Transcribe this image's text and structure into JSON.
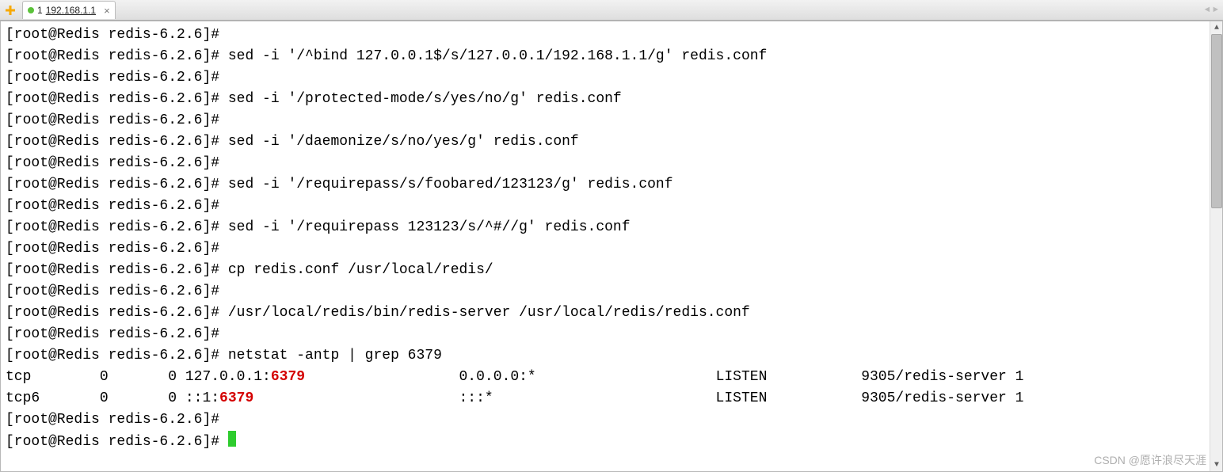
{
  "tab": {
    "index": "1",
    "title": "192.168.1.1",
    "close": "×"
  },
  "prompt": "[root@Redis redis-6.2.6]#",
  "lines": [
    {
      "cmd": ""
    },
    {
      "cmd": " sed -i '/^bind 127.0.0.1$/s/127.0.0.1/192.168.1.1/g' redis.conf"
    },
    {
      "cmd": ""
    },
    {
      "cmd": " sed -i '/protected-mode/s/yes/no/g' redis.conf"
    },
    {
      "cmd": ""
    },
    {
      "cmd": " sed -i '/daemonize/s/no/yes/g' redis.conf"
    },
    {
      "cmd": ""
    },
    {
      "cmd": " sed -i '/requirepass/s/foobared/123123/g' redis.conf"
    },
    {
      "cmd": ""
    },
    {
      "cmd": " sed -i '/requirepass 123123/s/^#//g' redis.conf"
    },
    {
      "cmd": ""
    },
    {
      "cmd": " cp redis.conf /usr/local/redis/"
    },
    {
      "cmd": ""
    },
    {
      "cmd": " /usr/local/redis/bin/redis-server /usr/local/redis/redis.conf"
    },
    {
      "cmd": ""
    },
    {
      "cmd": " netstat -antp | grep 6379"
    }
  ],
  "netstat": {
    "row1": {
      "proto": "tcp",
      "recvq": "0",
      "sendq": "0",
      "local_pre": "127.0.0.1:",
      "local_hl": "6379",
      "foreign": "0.0.0.0:*",
      "state": "LISTEN",
      "pid": "9305/redis-server 1"
    },
    "row2": {
      "proto": "tcp6",
      "recvq": "0",
      "sendq": "0",
      "local_pre": "::1:",
      "local_hl": "6379",
      "foreign": ":::*",
      "state": "LISTEN",
      "pid": "9305/redis-server 1"
    }
  },
  "trailing": [
    {
      "cmd": ""
    },
    {
      "cmd": " ",
      "cursor": true
    }
  ],
  "watermark": "CSDN @愿许浪尽天涯"
}
